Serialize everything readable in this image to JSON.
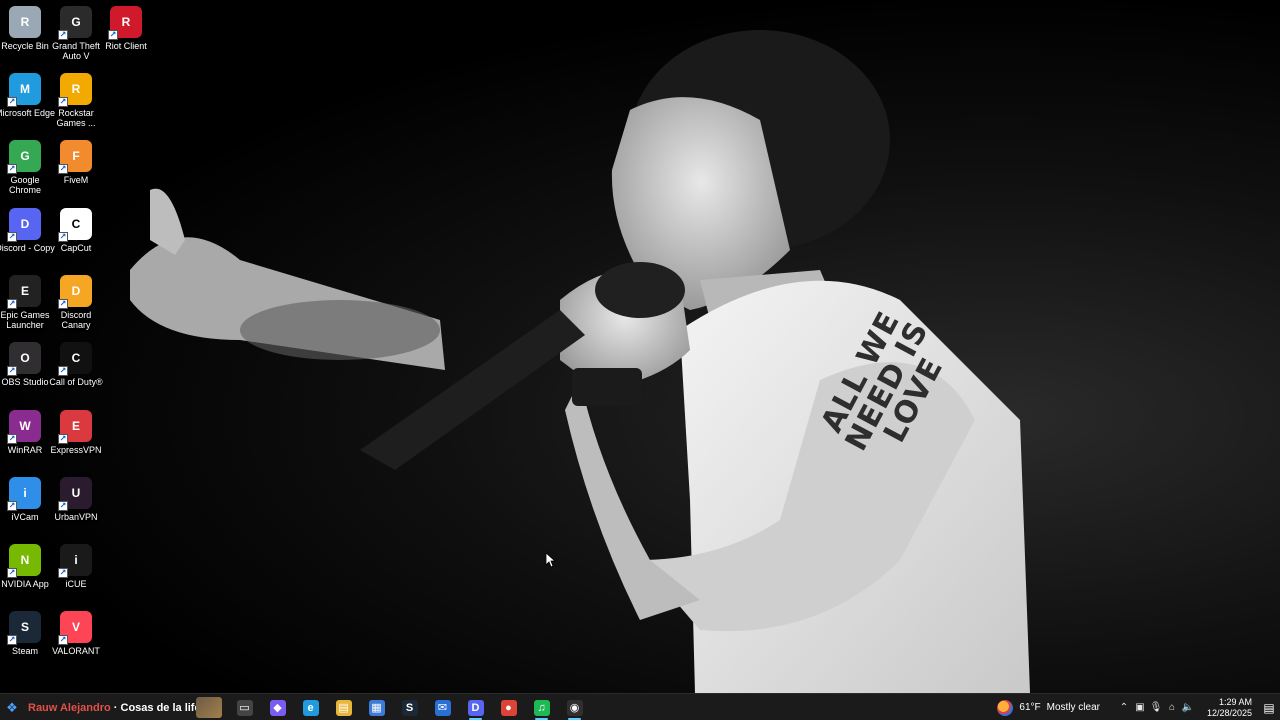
{
  "desktop": {
    "icons": [
      {
        "label": "Recycle Bin",
        "icon": "recycle-bin-icon",
        "color": "#9aa7b4"
      },
      {
        "label": "Grand Theft Auto V",
        "icon": "gta-v-icon",
        "color": "#2b2b2b"
      },
      {
        "label": "Riot Client",
        "icon": "riot-client-icon",
        "color": "#d1192c"
      },
      {
        "label": "Microsoft Edge",
        "icon": "edge-icon",
        "color": "#1f9bde"
      },
      {
        "label": "Rockstar Games ...",
        "icon": "rockstar-icon",
        "color": "#f2a900"
      },
      {
        "label": "Google Chrome",
        "icon": "chrome-icon",
        "color": "#34a853"
      },
      {
        "label": "FiveM",
        "icon": "fivem-icon",
        "color": "#f28a2e"
      },
      {
        "label": "Discord - Copy",
        "icon": "discord-icon",
        "color": "#5865f2"
      },
      {
        "label": "CapCut",
        "icon": "capcut-icon",
        "color": "#ffffff"
      },
      {
        "label": "Epic Games Launcher",
        "icon": "epic-games-icon",
        "color": "#222222"
      },
      {
        "label": "Discord Canary",
        "icon": "discord-canary-icon",
        "color": "#f5a623"
      },
      {
        "label": "OBS Studio",
        "icon": "obs-icon",
        "color": "#302e31"
      },
      {
        "label": "Call of Duty®",
        "icon": "call-of-duty-icon",
        "color": "#111111"
      },
      {
        "label": "WinRAR",
        "icon": "winrar-icon",
        "color": "#8a2c8f"
      },
      {
        "label": "ExpressVPN",
        "icon": "expressvpn-icon",
        "color": "#da3940"
      },
      {
        "label": "iVCam",
        "icon": "ivcam-icon",
        "color": "#2f8fe8"
      },
      {
        "label": "UrbanVPN",
        "icon": "urbanvpn-icon",
        "color": "#2a1b2e"
      },
      {
        "label": "NVIDIA App",
        "icon": "nvidia-icon",
        "color": "#76b900"
      },
      {
        "label": "iCUE",
        "icon": "icue-icon",
        "color": "#1a1a1a"
      },
      {
        "label": "Steam",
        "icon": "steam-icon",
        "color": "#1b2838"
      },
      {
        "label": "VALORANT",
        "icon": "valorant-icon",
        "color": "#fd4556"
      }
    ]
  },
  "wallpaper": {
    "tattoo": "ALL WE NEED IS LOVE"
  },
  "taskbar": {
    "now_playing": {
      "artist": "Rauw Alejandro",
      "separator": " · ",
      "title": "Cosas de la life"
    },
    "apps": [
      {
        "icon": "task-view-icon",
        "glyph": "▭",
        "color": "#444444",
        "active": false
      },
      {
        "icon": "copilot-icon",
        "glyph": "◆",
        "color": "#7a5cf0",
        "active": false
      },
      {
        "icon": "edge-icon",
        "glyph": "e",
        "color": "#1f9bde",
        "active": false
      },
      {
        "icon": "file-explorer-icon",
        "glyph": "▤",
        "color": "#e8b73a",
        "active": false
      },
      {
        "icon": "microsoft-store-icon",
        "glyph": "▦",
        "color": "#3c7bd7",
        "active": false
      },
      {
        "icon": "steam-icon",
        "glyph": "S",
        "color": "#1b2838",
        "active": false
      },
      {
        "icon": "mail-icon",
        "glyph": "✉",
        "color": "#2a6fd6",
        "active": false
      },
      {
        "icon": "discord-icon",
        "glyph": "D",
        "color": "#5865f2",
        "active": true
      },
      {
        "icon": "chrome-icon",
        "glyph": "●",
        "color": "#db4437",
        "active": false
      },
      {
        "icon": "spotify-icon",
        "glyph": "♫",
        "color": "#1db954",
        "active": true
      },
      {
        "icon": "obs-icon",
        "glyph": "◉",
        "color": "#302e31",
        "active": true
      }
    ],
    "weather": {
      "temp": "61°F",
      "condition": "Mostly clear"
    },
    "tray": {
      "time": "1:29 AM",
      "date": "12/28/2025"
    }
  }
}
